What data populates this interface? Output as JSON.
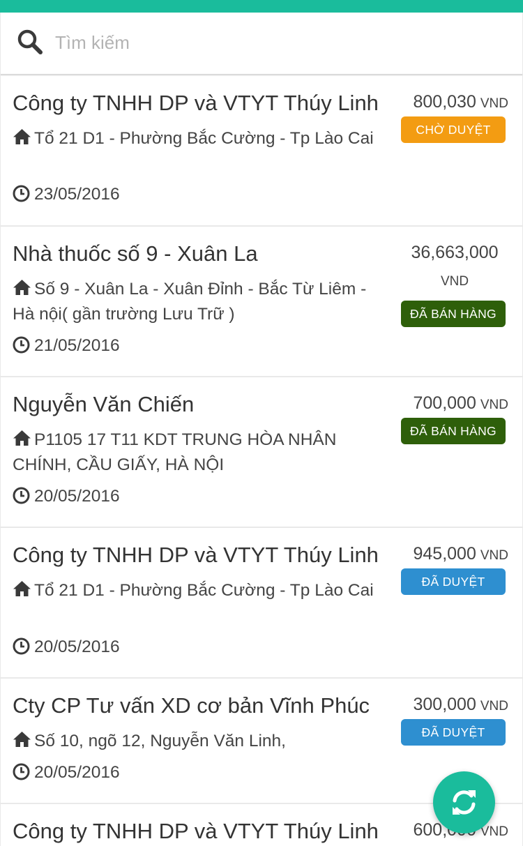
{
  "colors": {
    "topbar": "#1abc9c",
    "fab": "#1abc9c",
    "pending": "#f39c12",
    "sold": "#2e5f0a",
    "approved": "#2e8fd0"
  },
  "search": {
    "placeholder": "Tìm kiếm",
    "icon": "search-icon"
  },
  "orders": [
    {
      "name": "Công ty TNHH DP và VTYT Thúy Linh",
      "address": "Tổ 21 D1 - Phường Bắc Cường - Tp Lào Cai",
      "date": "23/05/2016",
      "amount": "800,030",
      "currency": "VND",
      "status": "CHỜ DUYỆT",
      "status_type": "pending"
    },
    {
      "name": "Nhà thuốc số 9 - Xuân La",
      "address": "Số 9 - Xuân La - Xuân Đỉnh - Bắc Từ Liêm - Hà nội( gần trường Lưu Trữ )",
      "date": "21/05/2016",
      "amount": "36,663,000",
      "currency": "VND",
      "status": "ĐÃ BÁN HÀNG",
      "status_type": "sold"
    },
    {
      "name": "Nguyễn Văn Chiến",
      "address": "P1105 17 T11 KDT TRUNG HÒA NHÂN CHÍNH, CẦU GIẤY, HÀ NỘI",
      "date": "20/05/2016",
      "amount": "700,000",
      "currency": "VND",
      "status": "ĐÃ BÁN HÀNG",
      "status_type": "sold"
    },
    {
      "name": "Công ty TNHH DP và VTYT Thúy Linh",
      "address": "Tổ 21 D1 - Phường Bắc Cường - Tp Lào Cai",
      "date": "20/05/2016",
      "amount": "945,000",
      "currency": "VND",
      "status": "ĐÃ DUYỆT",
      "status_type": "approved"
    },
    {
      "name": "Cty CP Tư vấn XD cơ bản Vĩnh Phúc",
      "address": "Số 10, ngõ 12, Nguyễn Văn Linh,",
      "date": "20/05/2016",
      "amount": "300,000",
      "currency": "VND",
      "status": "ĐÃ DUYỆT",
      "status_type": "approved"
    },
    {
      "name": "Công ty TNHH DP và VTYT Thúy Linh",
      "amount": "600,000",
      "currency": "VND"
    }
  ],
  "fab": {
    "icon": "refresh-icon"
  }
}
